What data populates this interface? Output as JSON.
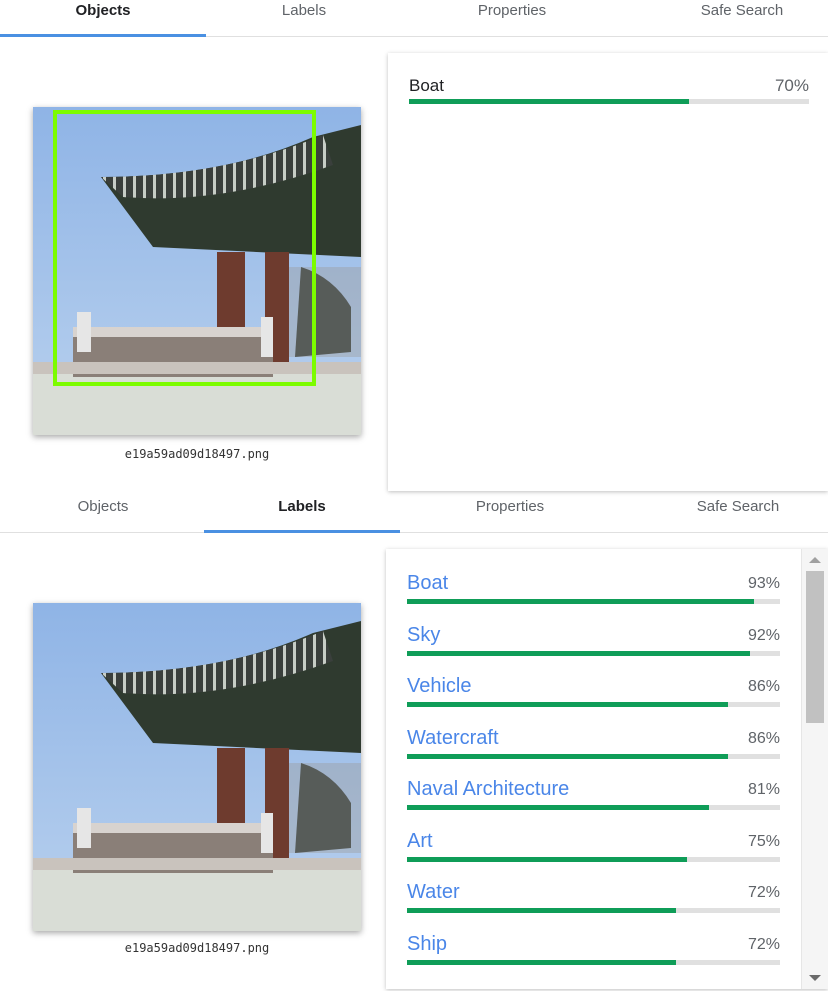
{
  "top": {
    "tabs": [
      "Objects",
      "Labels",
      "Properties",
      "Safe Search"
    ],
    "active_tab": 0,
    "image_caption": "e19a59ad09d18497.png",
    "objects": [
      {
        "label": "Boat",
        "percent_text": "70%",
        "fraction": 0.7
      }
    ]
  },
  "bottom": {
    "tabs": [
      "Objects",
      "Labels",
      "Properties",
      "Safe Search"
    ],
    "active_tab": 1,
    "image_caption": "e19a59ad09d18497.png",
    "labels": [
      {
        "label": "Boat",
        "percent_text": "93%",
        "fraction": 0.93
      },
      {
        "label": "Sky",
        "percent_text": "92%",
        "fraction": 0.92
      },
      {
        "label": "Vehicle",
        "percent_text": "86%",
        "fraction": 0.86
      },
      {
        "label": "Watercraft",
        "percent_text": "86%",
        "fraction": 0.86
      },
      {
        "label": "Naval Architecture",
        "percent_text": "81%",
        "fraction": 0.81
      },
      {
        "label": "Art",
        "percent_text": "75%",
        "fraction": 0.75
      },
      {
        "label": "Water",
        "percent_text": "72%",
        "fraction": 0.72
      },
      {
        "label": "Ship",
        "percent_text": "72%",
        "fraction": 0.72
      }
    ]
  },
  "colors": {
    "accent_tab": "#4a90e2",
    "bar_fill": "#0f9d58",
    "label_link": "#4a86e8",
    "bounding_box": "#7cfc00"
  }
}
